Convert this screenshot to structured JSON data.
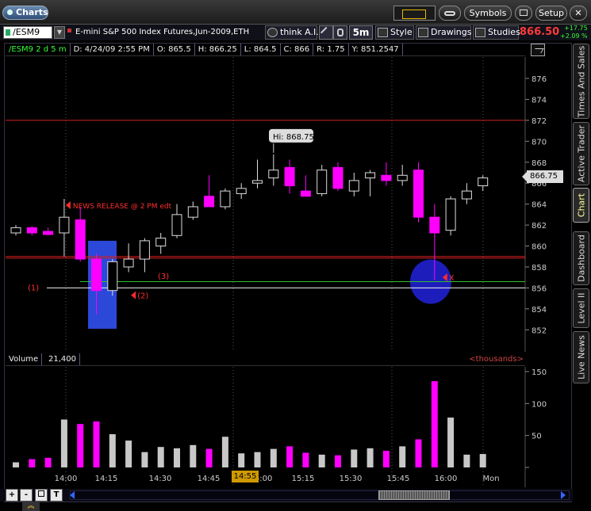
{
  "window": {
    "title": "Charts",
    "buttons": {
      "symbols": "Symbols",
      "setup": "Setup"
    }
  },
  "toolbar": {
    "symbol": "/ESM9",
    "description": "E-mini S&P 500 Index Futures,Jun-2009,ETH",
    "think_ai": "think A.I.",
    "timeframe": "5m",
    "style": "Style",
    "drawings": "Drawings",
    "studies": "Studies",
    "last_price": "866.50",
    "change_abs": "+17.75",
    "change_pct": "+2.09 %"
  },
  "info_bar": {
    "symbol_period": "/ESM9 2 d 5 m",
    "date": "D: 4/24/09 2:55 PM",
    "open": "O: 865.5",
    "high": "H: 866.25",
    "low": "L: 864.5",
    "close": "C: 866",
    "range": "R: 1.75",
    "y": "Y: 851.2547"
  },
  "price_tag": "866.75",
  "volume_panel": {
    "label": "Volume",
    "value": "21,400",
    "units": "<thousands>"
  },
  "time_highlight": "14:55",
  "side_tabs": [
    "Times And Sales",
    "Active Trader",
    "Chart",
    "Dashboard",
    "Level II",
    "Live News"
  ],
  "active_side_tab": "Chart",
  "bottom_buttons": [
    "+",
    "-",
    "T"
  ],
  "colors": {
    "up_candle": "#000000",
    "down_candle": "#ff00ff",
    "volume_up": "#c8c8c8",
    "volume_down": "#ff00ff",
    "accent_red": "#ff3b3b",
    "hline_red": "#d02020",
    "hline_green": "#2ec02e",
    "hline_white": "#f0f0f0",
    "highlight_blue": "#3355ff"
  },
  "chart_data": {
    "type": "candlestick",
    "price_axis": {
      "ylim": [
        851,
        877
      ],
      "ticks": [
        852,
        854,
        856,
        858,
        860,
        862,
        864,
        866,
        868,
        870,
        872,
        874,
        876
      ]
    },
    "volume_axis": {
      "ylim": [
        0,
        150
      ],
      "ticks": [
        50,
        100,
        150
      ]
    },
    "x_ticks": [
      "14:00",
      "14:15",
      "14:30",
      "14:45",
      "15:00",
      "15:15",
      "15:30",
      "15:45",
      "16:00",
      "Mon"
    ],
    "candles": [
      {
        "o": 861.25,
        "h": 862.0,
        "l": 861.0,
        "c": 861.75
      },
      {
        "o": 861.75,
        "h": 861.9,
        "l": 861.0,
        "c": 861.25
      },
      {
        "o": 861.4,
        "h": 861.75,
        "l": 861.0,
        "c": 861.1
      },
      {
        "o": 861.25,
        "h": 864.5,
        "l": 859.0,
        "c": 862.75
      },
      {
        "o": 862.5,
        "h": 863.75,
        "l": 858.5,
        "c": 858.75
      },
      {
        "o": 858.75,
        "h": 859.25,
        "l": 853.5,
        "c": 855.75
      },
      {
        "o": 855.75,
        "h": 858.75,
        "l": 855.25,
        "c": 858.5
      },
      {
        "o": 858.0,
        "h": 860.25,
        "l": 857.5,
        "c": 858.75
      },
      {
        "o": 858.75,
        "h": 860.75,
        "l": 857.5,
        "c": 860.5
      },
      {
        "o": 860.0,
        "h": 861.25,
        "l": 859.25,
        "c": 860.75
      },
      {
        "o": 861.0,
        "h": 864.0,
        "l": 860.75,
        "c": 863.0
      },
      {
        "o": 862.75,
        "h": 864.25,
        "l": 862.5,
        "c": 863.75
      },
      {
        "o": 864.75,
        "h": 866.75,
        "l": 863.75,
        "c": 863.75
      },
      {
        "o": 863.75,
        "h": 865.5,
        "l": 863.5,
        "c": 865.25
      },
      {
        "o": 865.0,
        "h": 866.0,
        "l": 864.5,
        "c": 865.5
      },
      {
        "o": 866.0,
        "h": 868.25,
        "l": 865.5,
        "c": 866.25
      },
      {
        "o": 866.5,
        "h": 868.75,
        "l": 865.75,
        "c": 867.25
      },
      {
        "o": 867.5,
        "h": 868.25,
        "l": 865.0,
        "c": 865.75
      },
      {
        "o": 865.25,
        "h": 866.75,
        "l": 864.75,
        "c": 864.75
      },
      {
        "o": 865.0,
        "h": 867.75,
        "l": 864.75,
        "c": 867.25
      },
      {
        "o": 867.5,
        "h": 868.0,
        "l": 865.25,
        "c": 865.5
      },
      {
        "o": 865.25,
        "h": 867.0,
        "l": 864.75,
        "c": 866.25
      },
      {
        "o": 866.5,
        "h": 867.25,
        "l": 864.75,
        "c": 867.0
      },
      {
        "o": 866.75,
        "h": 868.0,
        "l": 865.75,
        "c": 866.25
      },
      {
        "o": 866.25,
        "h": 867.75,
        "l": 865.75,
        "c": 866.75
      },
      {
        "o": 867.25,
        "h": 868.0,
        "l": 862.25,
        "c": 862.75
      },
      {
        "o": 862.75,
        "h": 864.0,
        "l": 856.75,
        "c": 861.25
      },
      {
        "o": 861.5,
        "h": 864.75,
        "l": 861.0,
        "c": 864.5
      },
      {
        "o": 864.5,
        "h": 866.0,
        "l": 864.0,
        "c": 865.25
      },
      {
        "o": 865.75,
        "h": 866.75,
        "l": 865.25,
        "c": 866.5
      }
    ],
    "volumes": [
      8,
      13,
      15,
      75,
      68,
      72,
      52,
      42,
      24,
      32,
      30,
      35,
      29,
      48,
      22,
      24,
      29,
      33,
      23,
      20,
      19,
      28,
      30,
      26,
      33,
      44,
      135,
      78,
      20,
      21
    ],
    "h_lines": [
      {
        "price": 872.0,
        "color": "hline_red"
      },
      {
        "price": 859.0,
        "color": "hline_red"
      },
      {
        "price": 858.85,
        "color": "hline_red"
      },
      {
        "price": 856.6,
        "color": "hline_green"
      },
      {
        "price": 856.0,
        "color": "hline_white"
      }
    ],
    "annotations": [
      {
        "text": "Hi: 868.75",
        "type": "callout"
      },
      {
        "text": "NEWS  RELEASE @ 2 PM edt",
        "type": "label"
      },
      {
        "text": "(1)",
        "type": "label"
      },
      {
        "text": "(2)",
        "type": "label"
      },
      {
        "text": "(3)",
        "type": "label"
      },
      {
        "text": "X",
        "type": "label"
      }
    ]
  }
}
